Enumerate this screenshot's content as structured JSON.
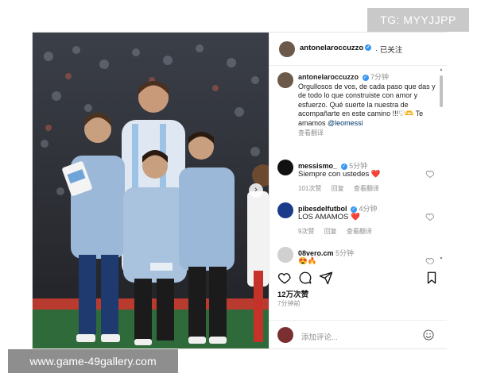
{
  "watermarks": {
    "top_right": "TG: MYYJJPP",
    "bottom_left": "www.game-49gallery.com"
  },
  "post": {
    "author": "antonelaroccuzzo",
    "header_follow": "· 已关注",
    "caption": {
      "username": "antonelaroccuzzo",
      "time": "7分钟",
      "text": "Orgullosos de vos, de cada paso que das y de todo lo que construiste  con amor y esfuerzo. Qué suerte la nuestra de acompañarte en este camino !!!♡🫶 Te amamos",
      "mention": "@leomessi",
      "translate": "查看翻译"
    },
    "comments": [
      {
        "username": "messismo_",
        "time": "5分钟",
        "text": "Siempre con ustedes",
        "emoji": "❤️",
        "likes": "101次赞",
        "reply": "回复",
        "translate": "查看翻译",
        "avatar_color": "#111111"
      },
      {
        "username": "pibesdelfutbol",
        "time": "4分钟",
        "text": "LOS AMAMOS",
        "emoji": "❤️",
        "likes": "9次赞",
        "reply": "回复",
        "translate": "查看翻译",
        "avatar_color": "#1b3a8a"
      },
      {
        "username": "08vero.cm",
        "time": "5分钟",
        "text": "😍🔥",
        "emoji": "",
        "likes": "",
        "reply": "",
        "translate": "",
        "avatar_color": "#d0d0d0"
      }
    ],
    "likes_count": "12万次赞",
    "posted_ago": "7分钟前",
    "add_comment_placeholder": "添加评论...",
    "icons": [
      "heart-icon",
      "comment-icon",
      "share-icon",
      "bookmark-icon",
      "emoji-icon",
      "next-arrow-icon"
    ]
  }
}
